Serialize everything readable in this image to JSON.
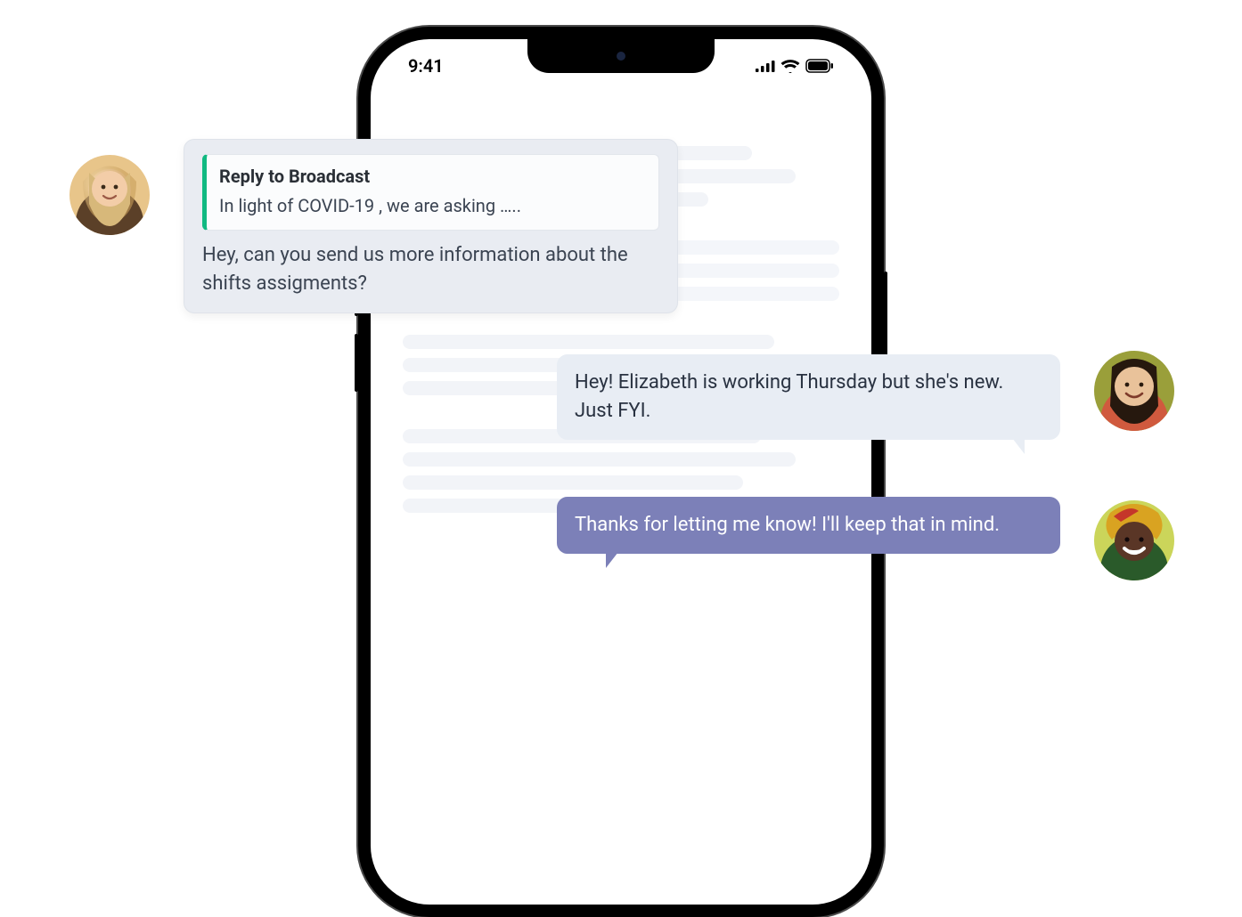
{
  "status": {
    "time": "9:41"
  },
  "bubbles": {
    "incoming": {
      "reply_title": "Reply to Broadcast",
      "reply_snippet": "In light of COVID-19 , we are asking …..",
      "text": "Hey, can you send us more information about the shifts assigments?"
    },
    "info": {
      "text": "Hey! Elizabeth is working Thursday but she's new. Just FYI."
    },
    "sent": {
      "text": "Thanks for letting me know! I'll keep that in mind."
    }
  },
  "avatars": {
    "a1": "avatar-woman-blonde",
    "a2": "avatar-woman-glasses",
    "a3": "avatar-woman-headwrap"
  }
}
